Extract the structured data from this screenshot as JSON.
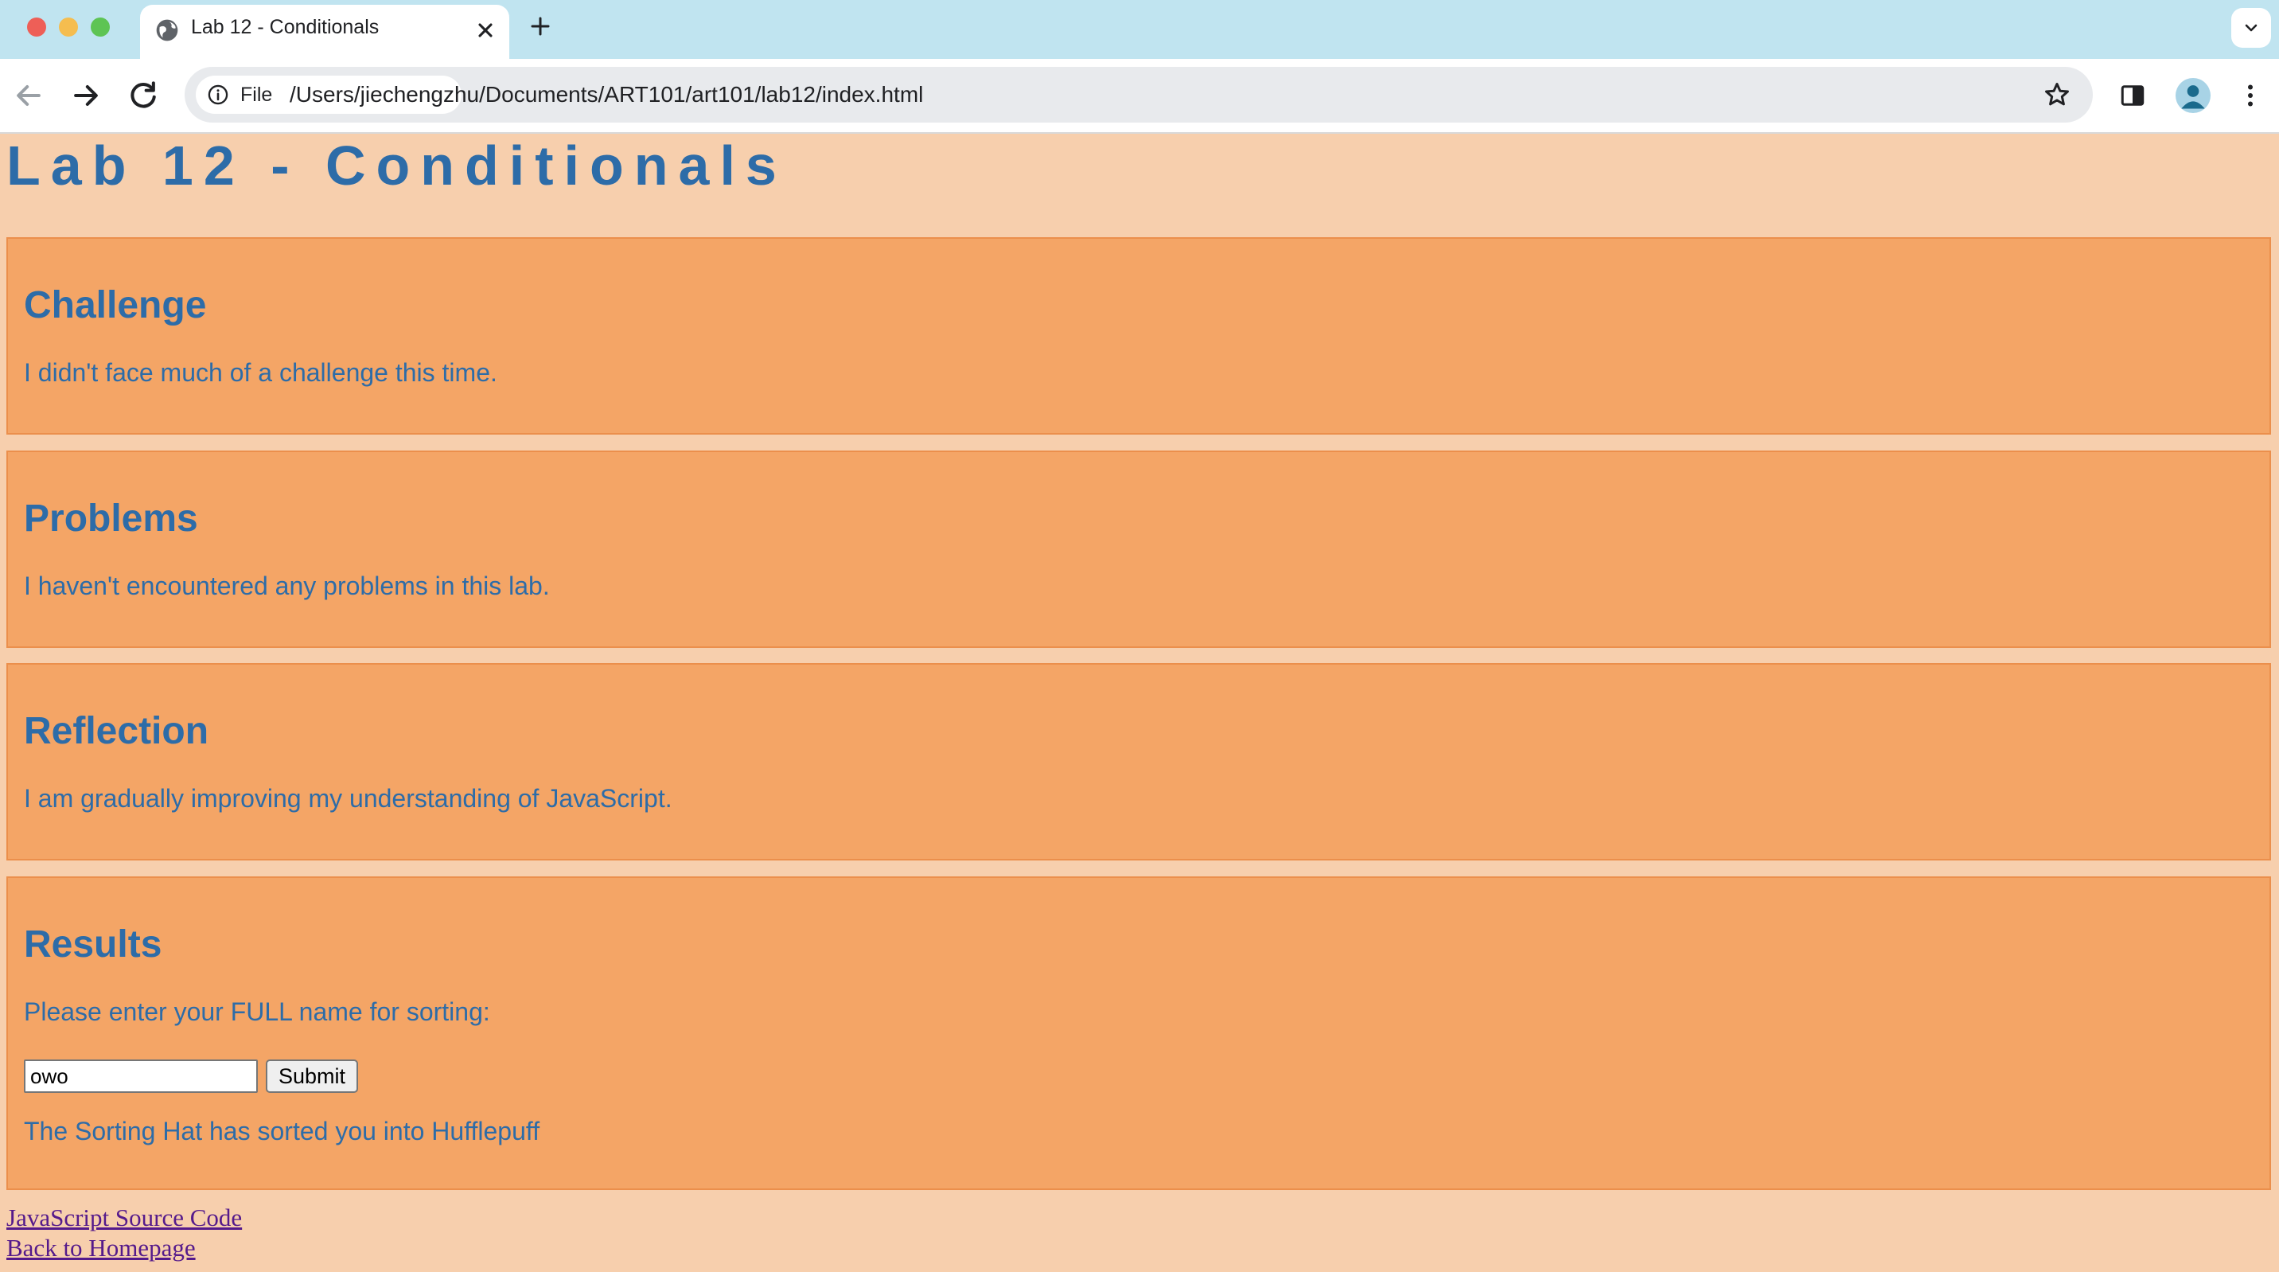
{
  "browser": {
    "tab_title": "Lab 12 - Conditionals",
    "new_tab_label": "+",
    "site_chip_label": "File",
    "url": "/Users/jiechengzhu/Documents/ART101/art101/lab12/index.html",
    "tab_bar_color": "#c0e4f0"
  },
  "page": {
    "title": "Lab 12 - Conditionals",
    "background": "#f7cfad",
    "accent_color": "#2d6ca8",
    "section_color": "#f4a566",
    "sections": [
      {
        "heading": "Challenge",
        "text": "I didn't face much of a challenge this time."
      },
      {
        "heading": "Problems",
        "text": "I haven't encountered any problems in this lab."
      },
      {
        "heading": "Reflection",
        "text": "I am gradually improving my understanding of JavaScript."
      }
    ],
    "results": {
      "heading": "Results",
      "prompt": "Please enter your FULL name for sorting:",
      "input_value": "owo",
      "submit_label": "Submit",
      "output": "The Sorting Hat has sorted you into Hufflepuff"
    },
    "links": [
      {
        "label": "JavaScript Source Code"
      },
      {
        "label": "Back to Homepage"
      }
    ]
  }
}
